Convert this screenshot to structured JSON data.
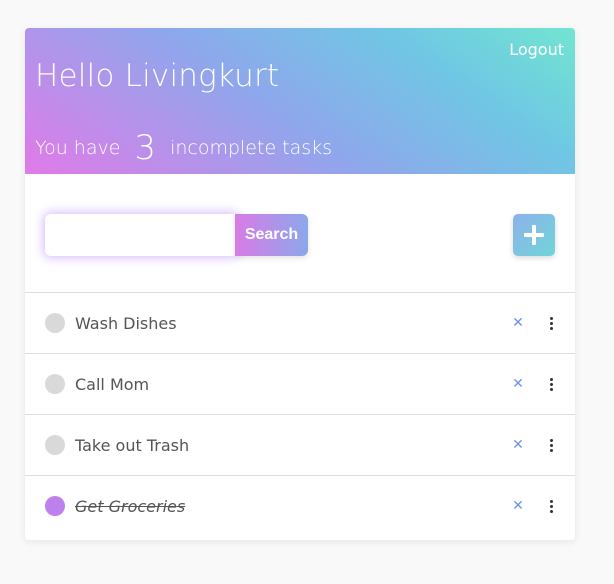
{
  "header": {
    "logout_label": "Logout",
    "greeting": "Hello Livingkurt",
    "summary_prefix": "You have",
    "incomplete_count": "3",
    "summary_suffix": "incomplete tasks"
  },
  "toolbar": {
    "search_value": "",
    "search_placeholder": "",
    "search_button_label": "Search",
    "add_icon": "plus-icon"
  },
  "tasks": [
    {
      "label": "Wash Dishes",
      "completed": false
    },
    {
      "label": "Call Mom",
      "completed": false
    },
    {
      "label": "Take out Trash",
      "completed": false
    },
    {
      "label": "Get Groceries",
      "completed": true
    }
  ],
  "colors": {
    "gradient_start": "#e07ae8",
    "gradient_mid": "#6fc7e4",
    "gradient_end": "#72e5d0",
    "completed_check": "#be80ec",
    "delete_icon": "#6c93e6"
  }
}
